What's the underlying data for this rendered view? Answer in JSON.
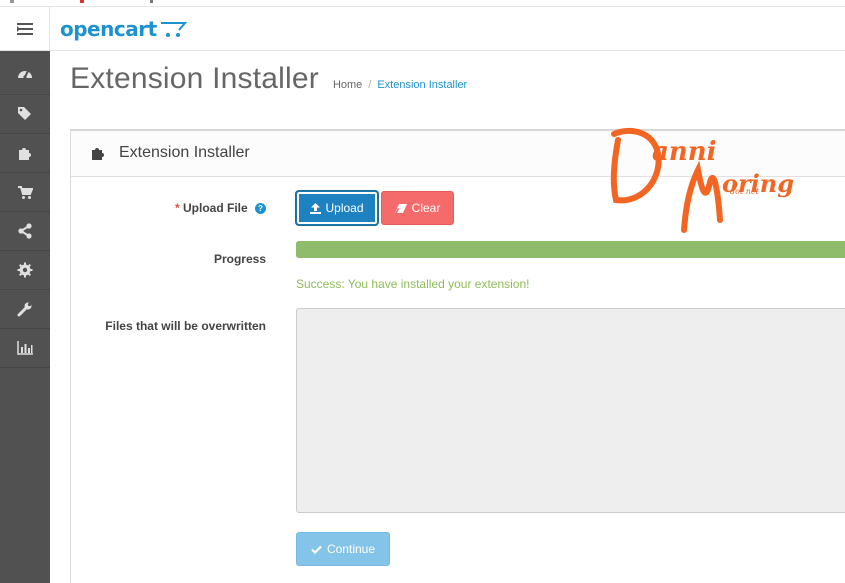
{
  "header": {
    "logo_text": "opencart",
    "menu_icon": "menu-toggle-icon"
  },
  "sidebar": {
    "items": [
      {
        "icon": "dashboard-icon"
      },
      {
        "icon": "tags-icon"
      },
      {
        "icon": "puzzle-icon"
      },
      {
        "icon": "shopping-cart-icon"
      },
      {
        "icon": "share-icon"
      },
      {
        "icon": "gear-icon"
      },
      {
        "icon": "wrench-icon"
      },
      {
        "icon": "bar-chart-icon"
      }
    ]
  },
  "page": {
    "title": "Extension Installer",
    "breadcrumb": {
      "home": "Home",
      "separator": "/",
      "current": "Extension Installer"
    }
  },
  "panel": {
    "title": "Extension Installer",
    "title_icon": "puzzle-icon"
  },
  "form": {
    "upload": {
      "required_mark": "*",
      "label": "Upload File",
      "help_icon_text": "?",
      "upload_button": "Upload",
      "clear_button": "Clear"
    },
    "progress": {
      "label": "Progress",
      "value_percent": 100,
      "message": "Success: You have installed your extension!"
    },
    "overwrite": {
      "label": "Files that will be overwritten"
    },
    "continue_button": "Continue"
  },
  "watermark": {
    "line1": "Danni",
    "line2": "Moring",
    "line3": "dot net"
  },
  "colors": {
    "brand_blue": "#1e91cf",
    "sidebar_bg": "#515151",
    "danger": "#f56b6b",
    "success": "#8fbc6a",
    "watermark_orange": "#f26522"
  }
}
